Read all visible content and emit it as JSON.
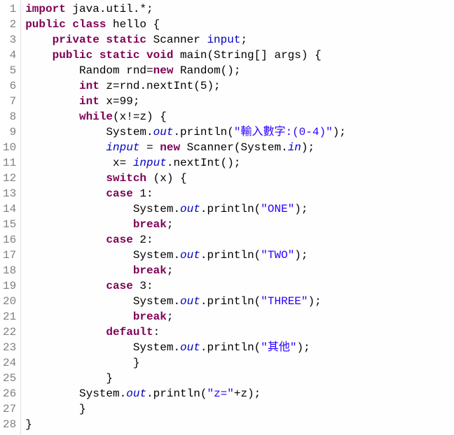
{
  "lines": [
    {
      "n": 1,
      "indent": 0,
      "tokens": [
        [
          "kw",
          "import"
        ],
        [
          "pln",
          " java.util.*;"
        ]
      ]
    },
    {
      "n": 2,
      "indent": 0,
      "tokens": [
        [
          "kw",
          "public class"
        ],
        [
          "pln",
          " hello {"
        ]
      ]
    },
    {
      "n": 3,
      "indent": 1,
      "tokens": [
        [
          "kw",
          "private static"
        ],
        [
          "pln",
          " Scanner "
        ],
        [
          "fld",
          "input"
        ],
        [
          "pln",
          ";"
        ]
      ]
    },
    {
      "n": 4,
      "indent": 1,
      "tokens": [
        [
          "kw",
          "public static void"
        ],
        [
          "pln",
          " main(String[] args) {"
        ]
      ]
    },
    {
      "n": 5,
      "indent": 2,
      "tokens": [
        [
          "pln",
          "Random rnd="
        ],
        [
          "kw",
          "new"
        ],
        [
          "pln",
          " Random();"
        ]
      ]
    },
    {
      "n": 6,
      "indent": 2,
      "tokens": [
        [
          "kw",
          "int"
        ],
        [
          "pln",
          " z=rnd.nextInt(5);"
        ]
      ]
    },
    {
      "n": 7,
      "indent": 2,
      "tokens": [
        [
          "kw",
          "int"
        ],
        [
          "pln",
          " x=99;"
        ]
      ]
    },
    {
      "n": 8,
      "indent": 2,
      "tokens": [
        [
          "kw",
          "while"
        ],
        [
          "pln",
          "(x!=z) {"
        ]
      ]
    },
    {
      "n": 9,
      "indent": 3,
      "tokens": [
        [
          "pln",
          "System."
        ],
        [
          "fldI",
          "out"
        ],
        [
          "pln",
          ".println("
        ],
        [
          "str",
          "\"輸入數字:(0-4)\""
        ],
        [
          "pln",
          ");"
        ]
      ]
    },
    {
      "n": 10,
      "indent": 3,
      "tokens": [
        [
          "fldI",
          "input"
        ],
        [
          "pln",
          " = "
        ],
        [
          "kw",
          "new"
        ],
        [
          "pln",
          " Scanner(System."
        ],
        [
          "fldI",
          "in"
        ],
        [
          "pln",
          ");"
        ]
      ]
    },
    {
      "n": 11,
      "indent": 3,
      "tokens": [
        [
          "pln",
          " x= "
        ],
        [
          "fldI",
          "input"
        ],
        [
          "pln",
          ".nextInt();"
        ]
      ]
    },
    {
      "n": 12,
      "indent": 3,
      "tokens": [
        [
          "kw",
          "switch"
        ],
        [
          "pln",
          " (x) {"
        ]
      ]
    },
    {
      "n": 13,
      "indent": 3,
      "tokens": [
        [
          "kw",
          "case"
        ],
        [
          "pln",
          " 1:"
        ]
      ]
    },
    {
      "n": 14,
      "indent": 4,
      "tokens": [
        [
          "pln",
          "System."
        ],
        [
          "fldI",
          "out"
        ],
        [
          "pln",
          ".println("
        ],
        [
          "str",
          "\"ONE\""
        ],
        [
          "pln",
          ");"
        ]
      ]
    },
    {
      "n": 15,
      "indent": 4,
      "tokens": [
        [
          "kw",
          "break"
        ],
        [
          "pln",
          ";"
        ]
      ]
    },
    {
      "n": 16,
      "indent": 3,
      "tokens": [
        [
          "kw",
          "case"
        ],
        [
          "pln",
          " 2:"
        ]
      ]
    },
    {
      "n": 17,
      "indent": 4,
      "tokens": [
        [
          "pln",
          "System."
        ],
        [
          "fldI",
          "out"
        ],
        [
          "pln",
          ".println("
        ],
        [
          "str",
          "\"TWO\""
        ],
        [
          "pln",
          ");"
        ]
      ]
    },
    {
      "n": 18,
      "indent": 4,
      "tokens": [
        [
          "kw",
          "break"
        ],
        [
          "pln",
          ";"
        ]
      ]
    },
    {
      "n": 19,
      "indent": 3,
      "tokens": [
        [
          "kw",
          "case"
        ],
        [
          "pln",
          " 3:"
        ]
      ]
    },
    {
      "n": 20,
      "indent": 4,
      "tokens": [
        [
          "pln",
          "System."
        ],
        [
          "fldI",
          "out"
        ],
        [
          "pln",
          ".println("
        ],
        [
          "str",
          "\"THREE\""
        ],
        [
          "pln",
          ");"
        ]
      ]
    },
    {
      "n": 21,
      "indent": 4,
      "tokens": [
        [
          "kw",
          "break"
        ],
        [
          "pln",
          ";"
        ]
      ]
    },
    {
      "n": 22,
      "indent": 3,
      "tokens": [
        [
          "kw",
          "default"
        ],
        [
          "pln",
          ":"
        ]
      ]
    },
    {
      "n": 23,
      "indent": 4,
      "tokens": [
        [
          "pln",
          "System."
        ],
        [
          "fldI",
          "out"
        ],
        [
          "pln",
          ".println("
        ],
        [
          "str",
          "\"其他\""
        ],
        [
          "pln",
          ");"
        ]
      ]
    },
    {
      "n": 24,
      "indent": 4,
      "tokens": [
        [
          "pln",
          "}"
        ]
      ]
    },
    {
      "n": 25,
      "indent": 3,
      "tokens": [
        [
          "pln",
          "}"
        ]
      ]
    },
    {
      "n": 26,
      "indent": 2,
      "tokens": [
        [
          "pln",
          "System."
        ],
        [
          "fldI",
          "out"
        ],
        [
          "pln",
          ".println("
        ],
        [
          "str",
          "\"z=\""
        ],
        [
          "pln",
          "+z);"
        ]
      ]
    },
    {
      "n": 27,
      "indent": 2,
      "tokens": [
        [
          "pln",
          "}"
        ]
      ]
    },
    {
      "n": 28,
      "indent": 0,
      "tokens": [
        [
          "pln",
          "}"
        ]
      ]
    }
  ],
  "indentUnit": "    "
}
